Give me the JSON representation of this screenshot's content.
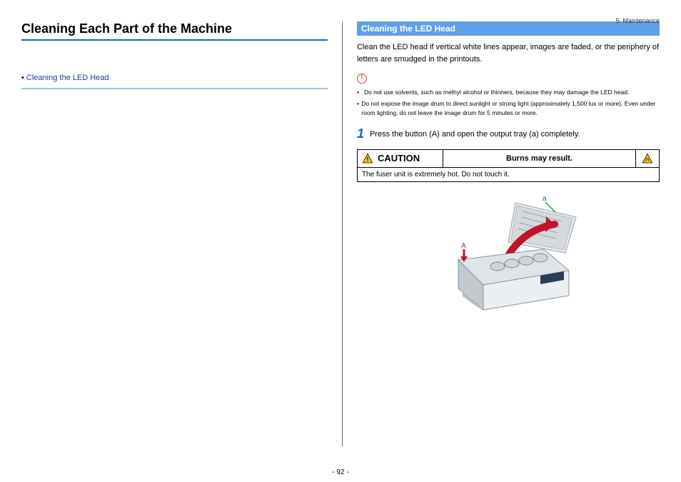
{
  "breadcrumb": "5. Maintenance",
  "left": {
    "title": "Cleaning Each Part of the Machine",
    "toc_item": "Cleaning the LED Head"
  },
  "right": {
    "section_title": "Cleaning the LED Head",
    "intro": "Clean the LED head if vertical white lines appear, images are faded, or the periphery of letters are smudged in the printouts.",
    "warnings": [
      "Do not use solvents, such as methyl alcohol or thinners, because they may damage the LED head.",
      "Do not expose the image drum to direct sunlight or strong light (approximately 1,500 lux or more). Even under room lighting, do not leave the image drum for 5 minutes or more."
    ],
    "step1_num": "1",
    "step1_text": "Press the button (A) and open the output tray (a) completely.",
    "caution_label": "CAUTION",
    "caution_msg": "Burns may result.",
    "caution_body": "The fuser unit is extremely hot. Do not touch it.",
    "diagram_labels": {
      "a": "a",
      "A": "A"
    }
  },
  "page_number": "- 92 -"
}
